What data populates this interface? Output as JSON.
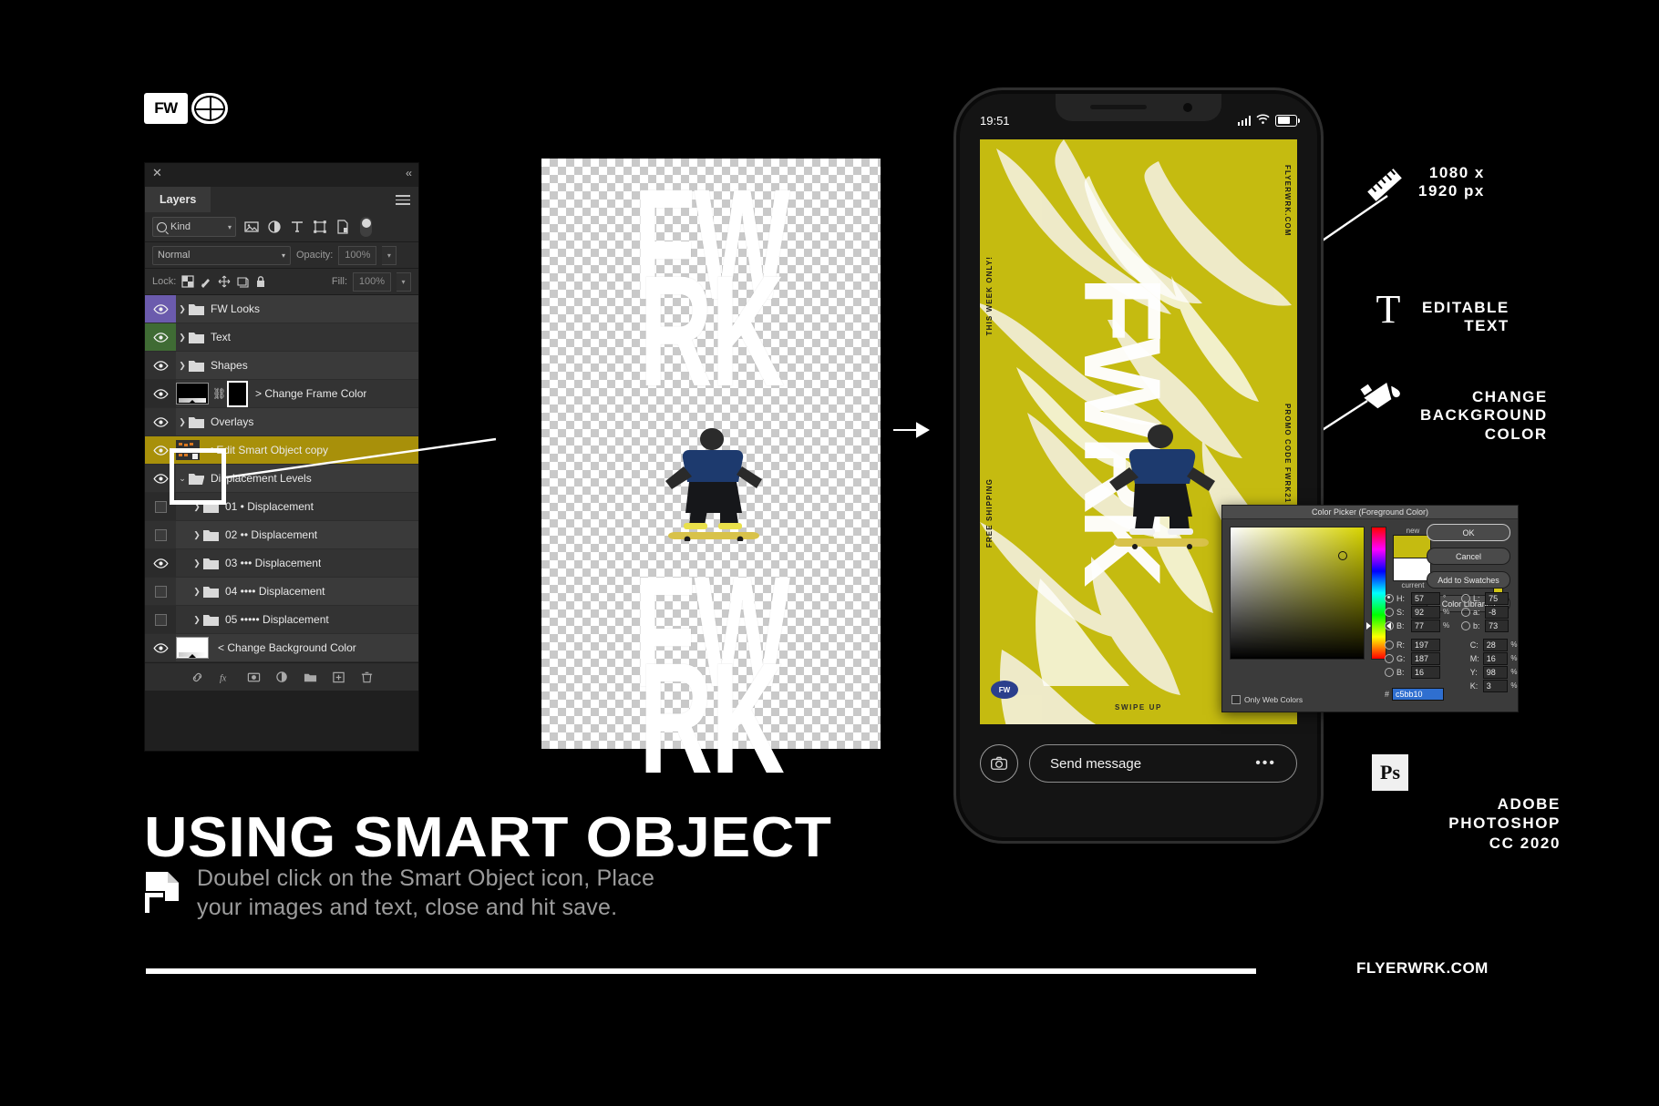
{
  "brand": {
    "mark_text": "FW",
    "globe_icon": "globe-icon"
  },
  "panel": {
    "close_icon": "close-icon",
    "collapse_icon": "double-chevron-left-icon",
    "tab_label": "Layers",
    "menu_icon": "panel-menu-icon",
    "filter": {
      "kind_label": "Kind",
      "search_icon": "search-icon",
      "chevron_icon": "chevron-down-icon",
      "filter_icons": [
        "image-filter-icon",
        "adjustment-filter-icon",
        "type-filter-icon",
        "shape-filter-icon",
        "smart-object-filter-icon"
      ],
      "toggle_icon": "filter-toggle-icon"
    },
    "blend": {
      "mode": "Normal",
      "opacity_label": "Opacity:",
      "opacity_value": "100%"
    },
    "lock": {
      "label": "Lock:",
      "icons": [
        "lock-transparency-icon",
        "lock-image-icon",
        "lock-position-icon",
        "lock-artboard-icon",
        "lock-all-icon"
      ],
      "fill_label": "Fill:",
      "fill_value": "100%"
    },
    "layers": [
      {
        "name": "FW Looks",
        "type": "group",
        "visible": true,
        "color": "purple",
        "expanded": false
      },
      {
        "name": "Text",
        "type": "group",
        "visible": true,
        "color": "green",
        "expanded": false
      },
      {
        "name": "Shapes",
        "type": "group",
        "visible": true,
        "color": "none",
        "expanded": false
      },
      {
        "name": "> Change Frame Color",
        "type": "solid-mask",
        "visible": true,
        "color": "none"
      },
      {
        "name": "Overlays",
        "type": "group",
        "visible": true,
        "color": "none",
        "expanded": false
      },
      {
        "name": "< Edit Smart Object copy",
        "type": "smart-object",
        "visible": true,
        "color": "yellow",
        "selected": true
      },
      {
        "name": "Displacement Levels",
        "type": "group",
        "visible": true,
        "color": "none",
        "expanded": true
      },
      {
        "name": "01 • Displacement",
        "type": "group",
        "visible": false,
        "color": "none",
        "nested": true
      },
      {
        "name": "02 •• Displacement",
        "type": "group",
        "visible": false,
        "color": "none",
        "nested": true
      },
      {
        "name": "03 ••• Displacement",
        "type": "group",
        "visible": true,
        "color": "none",
        "nested": true
      },
      {
        "name": "04 •••• Displacement",
        "type": "group",
        "visible": false,
        "color": "none",
        "nested": true
      },
      {
        "name": "05 ••••• Displacement",
        "type": "group",
        "visible": false,
        "color": "none",
        "nested": true
      },
      {
        "name": "< Change Background Color",
        "type": "solid-mask-white",
        "visible": true,
        "color": "none"
      }
    ],
    "footer_icons": [
      "link-layers-icon",
      "layer-style-fx-icon",
      "add-mask-icon",
      "adjustment-layer-icon",
      "new-group-icon",
      "new-layer-icon",
      "delete-layer-icon"
    ]
  },
  "artboard": {
    "line1": "FW",
    "line2": "RK",
    "line3": "FW",
    "line4": "RK",
    "subject_icon": "skateboarder-image"
  },
  "phone": {
    "status_time": "19:51",
    "signal_icon": "cellular-signal-icon",
    "wifi_icon": "wifi-icon",
    "battery_icon": "battery-icon",
    "poster": {
      "left_text_top": "THIS WEEK ONLY!",
      "left_text_bottom": "FREE SHIPPING",
      "right_text_top": "FLYERWRK.COM",
      "right_text_bottom": "PROMO CODE FWRK21",
      "big_word": "FWRK",
      "swipe_label": "SWIPE UP",
      "logo_text": "FW",
      "background_color": "#c5bb10"
    },
    "camera_icon": "camera-icon",
    "message_placeholder": "Send message",
    "more_icon": "more-options-icon"
  },
  "picker": {
    "title": "Color Picker (Foreground Color)",
    "new_label": "new",
    "current_label": "current",
    "new_swatch": "#c5bb10",
    "current_swatch": "#ffffff",
    "buttons": {
      "ok": "OK",
      "cancel": "Cancel",
      "swatches": "Add to Swatches",
      "libraries": "Color Libraries"
    },
    "hsb": [
      {
        "key": "H:",
        "value": "57",
        "unit": "°",
        "selected": true
      },
      {
        "key": "S:",
        "value": "92",
        "unit": "%",
        "selected": false
      },
      {
        "key": "B:",
        "value": "77",
        "unit": "%",
        "selected": false
      }
    ],
    "rgb": [
      {
        "key": "R:",
        "value": "197",
        "unit": "",
        "selected": false
      },
      {
        "key": "G:",
        "value": "187",
        "unit": "",
        "selected": false
      },
      {
        "key": "B:",
        "value": "16",
        "unit": "",
        "selected": false
      }
    ],
    "lab": [
      {
        "key": "L:",
        "value": "75",
        "unit": "",
        "selected": false
      },
      {
        "key": "a:",
        "value": "-8",
        "unit": "",
        "selected": false
      },
      {
        "key": "b:",
        "value": "73",
        "unit": "",
        "selected": false
      }
    ],
    "cmyk": [
      {
        "key": "C:",
        "value": "28",
        "unit": "%"
      },
      {
        "key": "M:",
        "value": "16",
        "unit": "%"
      },
      {
        "key": "Y:",
        "value": "98",
        "unit": "%"
      },
      {
        "key": "K:",
        "value": "3",
        "unit": "%"
      }
    ],
    "hex_label": "#",
    "hex_value": "c5bb10",
    "only_web_label": "Only Web Colors",
    "out_of_gamut_icon": "gamut-warning-icon"
  },
  "annotations": {
    "size": {
      "icon": "ruler-icon",
      "line1": "1080 x",
      "line2": "1920 px"
    },
    "text": {
      "icon": "type-tool-icon",
      "line1": "EDITABLE",
      "line2": "TEXT"
    },
    "background": {
      "icon": "paint-bucket-icon",
      "line1": "CHANGE",
      "line2": "BACKGROUND",
      "line3": "COLOR"
    },
    "software": {
      "badge": "Ps",
      "line1": "ADOBE",
      "line2": "PHOTOSHOP",
      "line3": "CC 2020"
    }
  },
  "footer": {
    "headline": "USING SMART OBJECT",
    "sub_line1": "Doubel click on the Smart Object icon, Place",
    "sub_line2": "your images and text, close and hit save.",
    "doc_icon": "smart-object-document-icon",
    "site": "FLYERWRK.COM"
  }
}
